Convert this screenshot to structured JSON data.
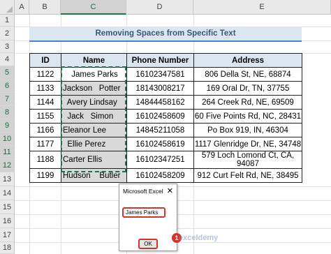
{
  "columns": [
    "A",
    "B",
    "C",
    "D",
    "E"
  ],
  "selected_column": "C",
  "rows": [
    "1",
    "2",
    "3",
    "4",
    "5",
    "6",
    "7",
    "8",
    "9",
    "10",
    "11",
    "12",
    "13",
    "14",
    "15",
    "16",
    "17",
    "18"
  ],
  "title": "Removing Spaces from Specific Text",
  "table": {
    "headers": [
      "ID",
      "Name",
      "Phone Number",
      "Address"
    ],
    "rows": [
      [
        "1122",
        "James Parks",
        "16102347581",
        "806 Della St, NE, 68874"
      ],
      [
        "1133",
        "Jackson   Potter",
        "18143008217",
        "169 Oral Dr, TN, 37755"
      ],
      [
        "1144",
        "  Avery Lindsay",
        "14844458162",
        "264 Creek Rd, NE, 69509"
      ],
      [
        "1155",
        "  Jack   Simon",
        "16102458609",
        "60 Five Points Rd, NC, 28431"
      ],
      [
        "1166",
        "Eleanor Lee",
        "14845211058",
        "Po Box 919, IN, 46304"
      ],
      [
        "1177",
        "  Ellie Perez",
        "16102458619",
        "1117 Glenridge Dr, NE, 34748"
      ],
      [
        "1188",
        "Carter Ellis",
        "16102347251",
        "579 Loch Lomond Ct, CA, 94087"
      ],
      [
        "1199",
        "Hudson    Butler",
        "16102458209",
        "912 Curt Felt Rd, NE, 38495"
      ]
    ]
  },
  "msgbox": {
    "title": "Microsoft Excel",
    "close": "✕",
    "text": "James Parks",
    "ok": "OK"
  },
  "badge": "1",
  "watermark": "exceldemy",
  "colors": {
    "accent": "#217346",
    "header_fill": "#dce6f1",
    "highlight": "#d0342c"
  }
}
